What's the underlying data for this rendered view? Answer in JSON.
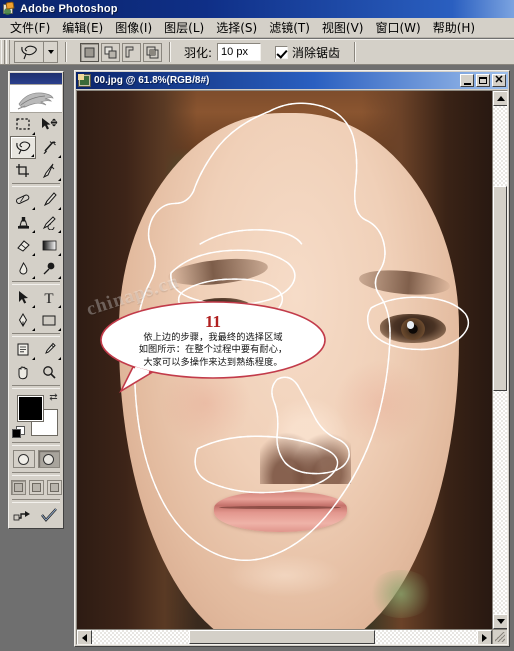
{
  "app": {
    "title": "Adobe Photoshop",
    "icon": "photoshop-icon"
  },
  "menubar": {
    "items": [
      {
        "label": "文件(F)",
        "name": "menu-file"
      },
      {
        "label": "编辑(E)",
        "name": "menu-edit"
      },
      {
        "label": "图像(I)",
        "name": "menu-image"
      },
      {
        "label": "图层(L)",
        "name": "menu-layer"
      },
      {
        "label": "选择(S)",
        "name": "menu-select"
      },
      {
        "label": "滤镜(T)",
        "name": "menu-filter"
      },
      {
        "label": "视图(V)",
        "name": "menu-view"
      },
      {
        "label": "窗口(W)",
        "name": "menu-window"
      },
      {
        "label": "帮助(H)",
        "name": "menu-help"
      }
    ]
  },
  "options_bar": {
    "active_tool": "lasso-tool",
    "selection_modes": [
      {
        "name": "new-selection",
        "active": true
      },
      {
        "name": "add-to-selection",
        "active": false
      },
      {
        "name": "subtract-from-selection",
        "active": false
      },
      {
        "name": "intersect-with-selection",
        "active": false
      }
    ],
    "feather_label": "羽化:",
    "feather_value": "10 px",
    "antialias_label": "消除锯齿",
    "antialias_checked": true
  },
  "toolbox": {
    "logo": "photoshop-feather-logo",
    "tools": [
      {
        "name": "marquee-tool",
        "glyph": "marquee",
        "selected": false,
        "has_flyout": true
      },
      {
        "name": "move-tool",
        "glyph": "move",
        "selected": false,
        "has_flyout": false
      },
      {
        "name": "lasso-tool",
        "glyph": "lasso",
        "selected": true,
        "has_flyout": true
      },
      {
        "name": "magic-wand-tool",
        "glyph": "wand",
        "selected": false,
        "has_flyout": false
      },
      {
        "name": "crop-tool",
        "glyph": "crop",
        "selected": false,
        "has_flyout": false
      },
      {
        "name": "slice-tool",
        "glyph": "slice",
        "selected": false,
        "has_flyout": true
      },
      {
        "name": "healing-brush-tool",
        "glyph": "heal",
        "selected": false,
        "has_flyout": true
      },
      {
        "name": "brush-tool",
        "glyph": "brush",
        "selected": false,
        "has_flyout": true
      },
      {
        "name": "clone-stamp-tool",
        "glyph": "stamp",
        "selected": false,
        "has_flyout": true
      },
      {
        "name": "history-brush-tool",
        "glyph": "historybrush",
        "selected": false,
        "has_flyout": true
      },
      {
        "name": "eraser-tool",
        "glyph": "eraser",
        "selected": false,
        "has_flyout": true
      },
      {
        "name": "gradient-tool",
        "glyph": "gradient",
        "selected": false,
        "has_flyout": true
      },
      {
        "name": "blur-tool",
        "glyph": "blur",
        "selected": false,
        "has_flyout": true
      },
      {
        "name": "dodge-tool",
        "glyph": "dodge",
        "selected": false,
        "has_flyout": true
      },
      {
        "name": "path-selection-tool",
        "glyph": "pathsel",
        "selected": false,
        "has_flyout": true
      },
      {
        "name": "type-tool",
        "glyph": "type",
        "selected": false,
        "has_flyout": true
      },
      {
        "name": "pen-tool",
        "glyph": "pen",
        "selected": false,
        "has_flyout": true
      },
      {
        "name": "rectangle-tool",
        "glyph": "shape",
        "selected": false,
        "has_flyout": true
      },
      {
        "name": "notes-tool",
        "glyph": "notes",
        "selected": false,
        "has_flyout": true
      },
      {
        "name": "eyedropper-tool",
        "glyph": "eyedropper",
        "selected": false,
        "has_flyout": true
      },
      {
        "name": "hand-tool",
        "glyph": "hand",
        "selected": false,
        "has_flyout": false
      },
      {
        "name": "zoom-tool",
        "glyph": "zoom",
        "selected": false,
        "has_flyout": false
      }
    ],
    "colors": {
      "foreground": "#000000",
      "background": "#ffffff",
      "swap_icon": "swap-colors-icon",
      "default_icon": "default-colors-icon"
    },
    "quickmask": [
      {
        "name": "standard-mode-button",
        "active": false
      },
      {
        "name": "quick-mask-mode-button",
        "active": true
      }
    ],
    "screenmodes": [
      {
        "name": "standard-screen-mode-button",
        "active": true
      },
      {
        "name": "full-screen-with-menubar-button",
        "active": false
      },
      {
        "name": "full-screen-mode-button",
        "active": false
      }
    ],
    "jump_to": {
      "name": "jump-to-imageready-button"
    }
  },
  "document": {
    "title": "00.jpg @ 61.8%(RGB/8#)",
    "icon": "document-thumbnail-icon",
    "minimize_label": "",
    "maximize_label": "",
    "close_label": "✕",
    "zoom_percent": "61.8%",
    "color_mode": "RGB/8#",
    "filename": "00.jpg",
    "watermark": "chinaps.cn",
    "scrollbars": {
      "vertical": {
        "thumb_top_pct": 16,
        "thumb_height_pct": 40
      },
      "horizontal": {
        "thumb_left_pct": 27,
        "thumb_width_pct": 46
      }
    }
  },
  "annotation": {
    "number": "11",
    "line1": "依上边的步骤，我最终的选择区域",
    "line2": "如图所示：在整个过程中要有耐心，",
    "line3": "大家可以多操作来达到熟练程度。",
    "border_color": "#c23b4a",
    "number_color": "#b02020"
  }
}
